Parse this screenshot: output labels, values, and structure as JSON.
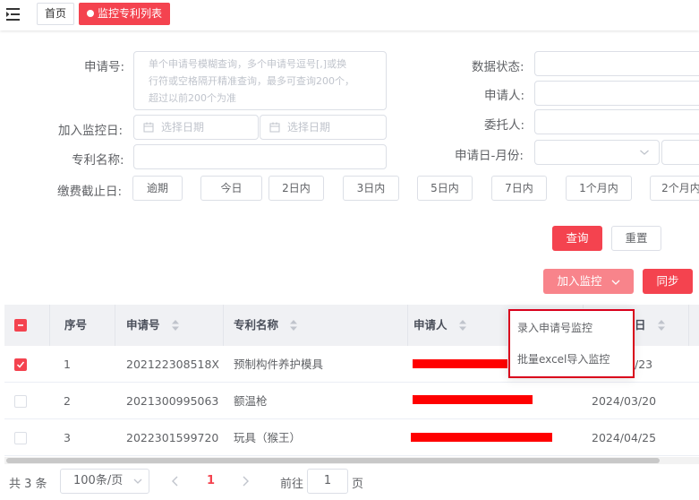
{
  "topbar": {
    "menu_icon": "hamburger-menu-icon",
    "tabs": [
      {
        "label": "首页"
      },
      {
        "label": "监控专利列表",
        "active": true
      }
    ]
  },
  "search": {
    "application_no": {
      "label": "申请号:",
      "placeholder": "单个申请号模糊查询，多个申请号逗号[,]或换行符或空格隔开精准查询，最多可查询200个，超过以前200个为准",
      "placeholder_lines": [
        "单个申请号模糊查询，多个申请号逗号[,]或换",
        "行符或空格隔开精准查询，最多可查询200个，",
        "超过以前200个为准"
      ]
    },
    "data_status": {
      "label": "数据状态:"
    },
    "applicant": {
      "label": "申请人:"
    },
    "monitor_date": {
      "label": "加入监控日:",
      "start_placeholder": "选择日期",
      "end_placeholder": "选择日期"
    },
    "agent": {
      "label": "委托人:"
    },
    "patent_name": {
      "label": "专利名称:"
    },
    "apply_month": {
      "label": "申请日-月份:"
    },
    "fee_deadline": {
      "label": "缴费截止日:",
      "options": [
        "逾期",
        "今日",
        "2日内",
        "3日内",
        "5日内",
        "7日内",
        "1个月内",
        "2个月内"
      ]
    },
    "query_button": "查询",
    "reset_button": "重置"
  },
  "actions": {
    "add_monitor": "加入监控",
    "sync": "同步",
    "dropdown_items": [
      "录入申请号监控",
      "批量excel导入监控"
    ]
  },
  "table": {
    "columns": [
      "序号",
      "申请号",
      "专利名称",
      "申请人",
      "日"
    ],
    "rows": [
      {
        "index": "1",
        "application_no": "202122308518X",
        "name": "预制构件养护模具",
        "date": "/23",
        "checked": true
      },
      {
        "index": "2",
        "application_no": "2021300995063",
        "name": "额温枪",
        "date": "2024/03/20",
        "checked": false
      },
      {
        "index": "3",
        "application_no": "2022301599720",
        "name": "玩具（猴王）",
        "date": "2024/04/25",
        "checked": false
      }
    ]
  },
  "pagination": {
    "total": "共 3 条",
    "page_size": "100条/页",
    "current_page": "1",
    "goto_prefix": "前往",
    "goto_value": "1",
    "goto_suffix": "页"
  },
  "colors": {
    "accent": "#f4434f",
    "accent_light": "#f8848b",
    "highlight_border": "#d9001b",
    "redaction": "#ff0000"
  }
}
